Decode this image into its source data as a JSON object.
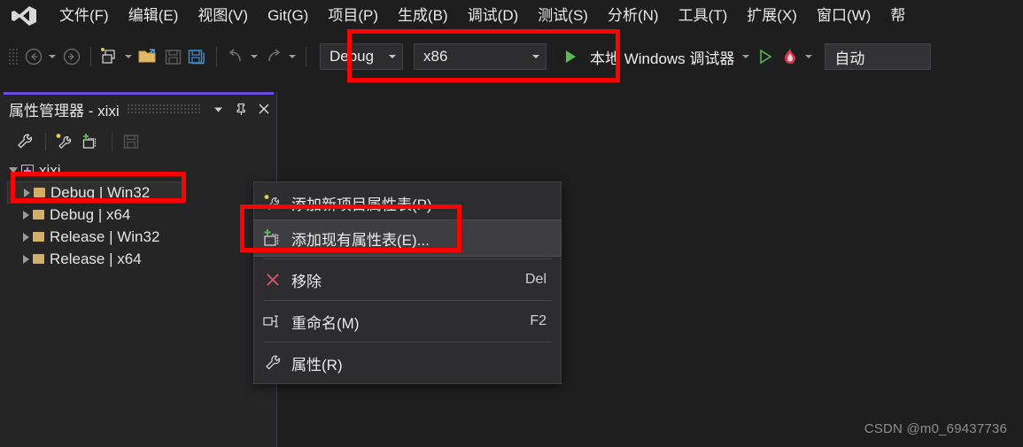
{
  "app": {
    "title": "Visual Studio",
    "logo_icon": "visual-studio-logo-icon"
  },
  "menubar": {
    "items": [
      {
        "label": "文件(F)"
      },
      {
        "label": "编辑(E)"
      },
      {
        "label": "视图(V)"
      },
      {
        "label": "Git(G)"
      },
      {
        "label": "项目(P)"
      },
      {
        "label": "生成(B)"
      },
      {
        "label": "调试(D)"
      },
      {
        "label": "测试(S)"
      },
      {
        "label": "分析(N)"
      },
      {
        "label": "工具(T)"
      },
      {
        "label": "扩展(X)"
      },
      {
        "label": "窗口(W)"
      },
      {
        "label": "帮"
      }
    ]
  },
  "toolbar": {
    "back_icon": "back-arrow-icon",
    "forward_icon": "forward-arrow-icon",
    "new_project_icon": "new-project-icon",
    "open_icon": "open-folder-icon",
    "save_icon": "save-icon",
    "save_all_icon": "save-all-icon",
    "undo_icon": "undo-icon",
    "redo_icon": "redo-icon",
    "configuration": "Debug",
    "platform": "x86",
    "run_label": "本地 Windows 调试器",
    "run_icon": "green-play-icon",
    "start_icon": "start-play-icon",
    "hotreload_icon": "hot-reload-flame-icon",
    "auto_value": "自动"
  },
  "panel": {
    "title": "属性管理器 - xixi",
    "accent_color": "#6b4ce0",
    "dropdown_icon": "chevron-down-icon",
    "pin_icon": "pin-icon",
    "close_icon": "close-icon",
    "tools": [
      {
        "name": "properties-wrench-icon"
      },
      {
        "name": "add-new-property-sheet-icon"
      },
      {
        "name": "add-existing-property-sheet-icon"
      },
      {
        "name": "save-property-sheet-icon"
      }
    ],
    "tree": {
      "root": {
        "label": "xixi",
        "icon": "solution-icon"
      },
      "children": [
        {
          "label": "Debug | Win32",
          "icon": "folder-icon",
          "selected": true
        },
        {
          "label": "Debug | x64",
          "icon": "folder-icon",
          "selected": false
        },
        {
          "label": "Release | Win32",
          "icon": "folder-icon",
          "selected": false
        },
        {
          "label": "Release | x64",
          "icon": "folder-icon",
          "selected": false
        }
      ]
    }
  },
  "context_menu": {
    "items": [
      {
        "label": "添加新项目属性表(P)",
        "shortcut": "",
        "icon": "add-new-sheet-icon",
        "highlighted": false
      },
      {
        "label": "添加现有属性表(E)...",
        "shortcut": "",
        "icon": "add-existing-sheet-icon",
        "highlighted": true
      },
      {
        "label": "移除",
        "shortcut": "Del",
        "icon": "remove-x-icon",
        "highlighted": false
      },
      {
        "label": "重命名(M)",
        "shortcut": "F2",
        "icon": "rename-icon",
        "highlighted": false
      },
      {
        "label": "属性(R)",
        "shortcut": "",
        "icon": "properties-wrench-icon",
        "highlighted": false
      }
    ]
  },
  "annotations": {
    "color": "#fe0000",
    "boxes": [
      {
        "name": "toolbar-configuration-highlight"
      },
      {
        "name": "tree-debug-win32-highlight"
      },
      {
        "name": "menu-add-existing-highlight"
      }
    ]
  },
  "watermark": {
    "text": "CSDN @m0_69437736"
  }
}
